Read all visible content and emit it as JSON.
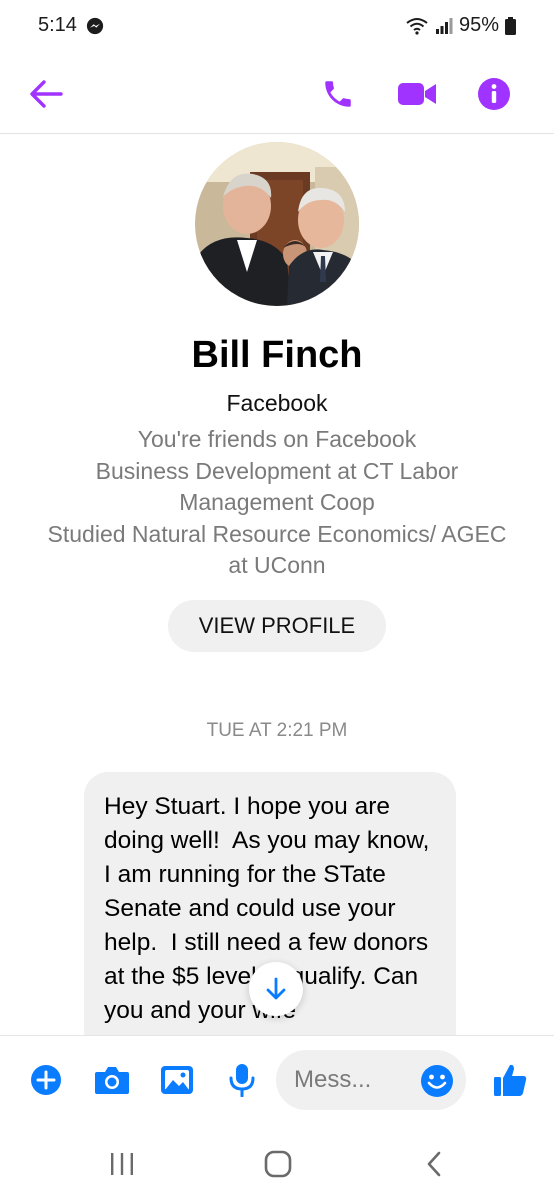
{
  "status_bar": {
    "time": "5:14",
    "battery": "95%"
  },
  "header": {
    "accent_color": "#a033ff",
    "icons": [
      "back-arrow-icon",
      "phone-icon",
      "video-call-icon",
      "info-icon"
    ]
  },
  "profile": {
    "name": "Bill Finch",
    "source": "Facebook",
    "friends_note": "You're friends on Facebook",
    "work": "Business Development at CT Labor Management Coop",
    "education": "Studied Natural Resource Economics/ AGEC at UConn",
    "view_profile_label": "VIEW PROFILE"
  },
  "conversation": {
    "timestamp": "TUE AT 2:21 PM",
    "messages": [
      {
        "text": "Hey Stuart. I hope you are doing well!  As you may know, I am running for the STate Senate and could use your help.  I still need a few donors at the $5 level to qualify. Can you and your wife"
      }
    ]
  },
  "composer": {
    "placeholder": "Mess...",
    "accent_color": "#0a7cff",
    "icons": [
      "plus-icon",
      "camera-icon",
      "gallery-icon",
      "microphone-icon",
      "emoji-icon",
      "thumbs-up-icon"
    ]
  },
  "nav": {
    "icons": [
      "recent-apps-icon",
      "home-icon",
      "back-icon"
    ]
  }
}
